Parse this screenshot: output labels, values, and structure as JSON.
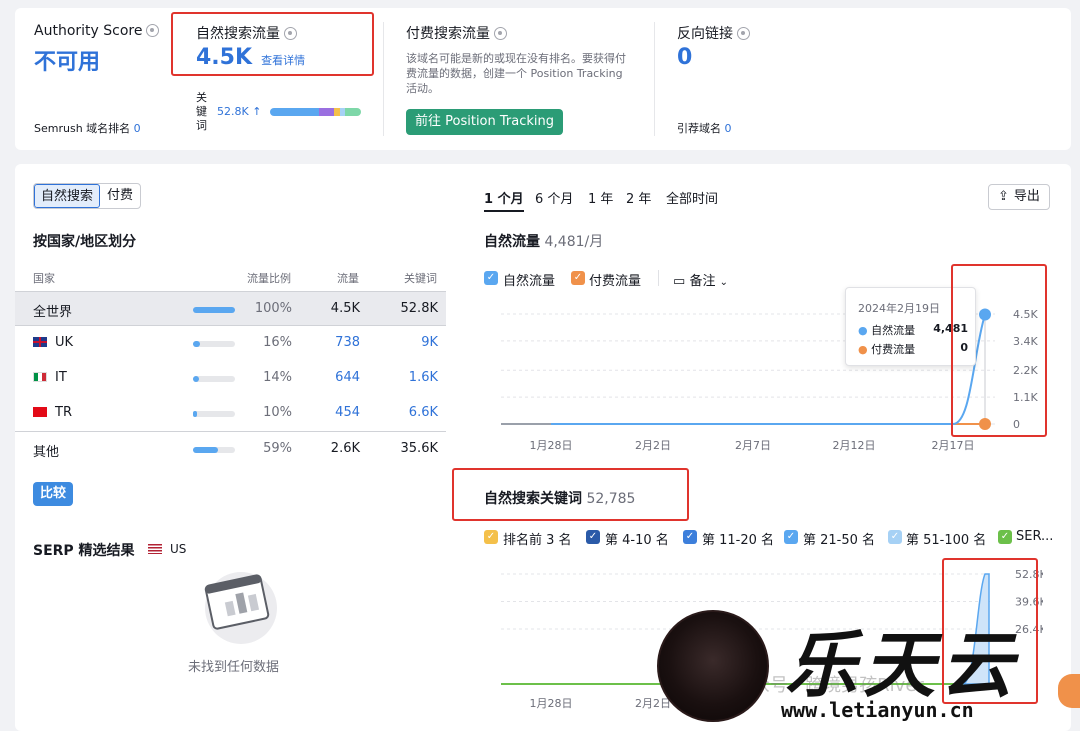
{
  "top": {
    "authority": {
      "label": "Authority Score",
      "value": "不可用",
      "rank_label": "Semrush 域名排名",
      "rank_value": "0"
    },
    "organic": {
      "label": "自然搜索流量",
      "value": "4.5K",
      "link": "查看详情",
      "kw_label": "关\n键\n词",
      "kw_value": "52.8K ↑"
    },
    "paid": {
      "label": "付费搜索流量",
      "desc": "该域名可能是新的或现在没有排名。要获得付费流量的数据，创建一个 Position Tracking 活动。",
      "button": "前往 Position Tracking"
    },
    "backlinks": {
      "label": "反向链接",
      "value": "0",
      "ref_label": "引荐域名",
      "ref_value": "0"
    }
  },
  "colors": {
    "accent": "#2f72d8",
    "organic": "#5aa7f0",
    "paid": "#f0914a",
    "green_btn": "#2b9c76",
    "compare_btn": "#3d8be0",
    "highlight": "#e0342d"
  },
  "left": {
    "toggle": [
      "自然搜索",
      "付费"
    ],
    "country_title": "按国家/地区划分",
    "headers": [
      "国家",
      "流量比例",
      "流量",
      "关键词"
    ],
    "rows": [
      {
        "country": "全世界",
        "flag": "",
        "share": "100%",
        "share_num": 100,
        "traffic": "4.5K",
        "keywords": "52.8K"
      },
      {
        "country": "UK",
        "flag": "uk",
        "share": "16%",
        "share_num": 16,
        "traffic": "738",
        "keywords": "9K"
      },
      {
        "country": "IT",
        "flag": "it",
        "share": "14%",
        "share_num": 14,
        "traffic": "644",
        "keywords": "1.6K"
      },
      {
        "country": "TR",
        "flag": "tr",
        "share": "10%",
        "share_num": 10,
        "traffic": "454",
        "keywords": "6.6K"
      },
      {
        "country": "其他",
        "flag": "",
        "share": "59%",
        "share_num": 59,
        "traffic": "2.6K",
        "keywords": "35.6K"
      }
    ],
    "compare_button": "比较",
    "serp_title": "SERP 精选结果",
    "serp_region": "US",
    "empty_text": "未找到任何数据"
  },
  "right": {
    "ranges": [
      "1 个月",
      "6 个月",
      "1 年",
      "2 年",
      "全部时间"
    ],
    "export": "导出",
    "traffic_title": "自然流量",
    "traffic_sub": "4,481/月",
    "legend": [
      "自然流量",
      "付费流量"
    ],
    "notes": "备注",
    "tooltip": {
      "date": "2024年2月19日",
      "rows": [
        {
          "label": "自然流量",
          "value": "4,481"
        },
        {
          "label": "付费流量",
          "value": "0"
        }
      ]
    },
    "kw_title": "自然搜索关键词",
    "kw_sub": "52,785",
    "kw_legend": [
      "排名前 3 名",
      "第 4-10 名",
      "第 11-20 名",
      "第 21-50 名",
      "第 51-100 名",
      "SER..."
    ]
  },
  "chart_data": [
    {
      "type": "line",
      "title": "自然流量",
      "x": [
        "1月28日",
        "2月2日",
        "2月7日",
        "2月12日",
        "2月17日",
        "2月19日"
      ],
      "series": [
        {
          "name": "自然流量",
          "values": [
            0,
            0,
            0,
            0,
            0,
            4481
          ]
        },
        {
          "name": "付费流量",
          "values": [
            0,
            0,
            0,
            0,
            0,
            0
          ]
        }
      ],
      "yticks": [
        "0",
        "1.1K",
        "2.2K",
        "3.4K",
        "4.5K"
      ],
      "ylim": [
        0,
        4500
      ]
    },
    {
      "type": "area",
      "title": "自然搜索关键词",
      "x": [
        "1月28日",
        "2月2日"
      ],
      "series": [
        {
          "name": "第 51-100 名",
          "values": [
            0,
            0,
            0,
            0,
            0,
            52785
          ]
        }
      ],
      "yticks": [
        "52.8K",
        "39.6K",
        "26.4K"
      ],
      "ylim": [
        0,
        52800
      ]
    }
  ],
  "watermark": {
    "text": "乐天云",
    "url": "www.letianyun.cn",
    "faint": "众号 · 跨境男孩River"
  }
}
